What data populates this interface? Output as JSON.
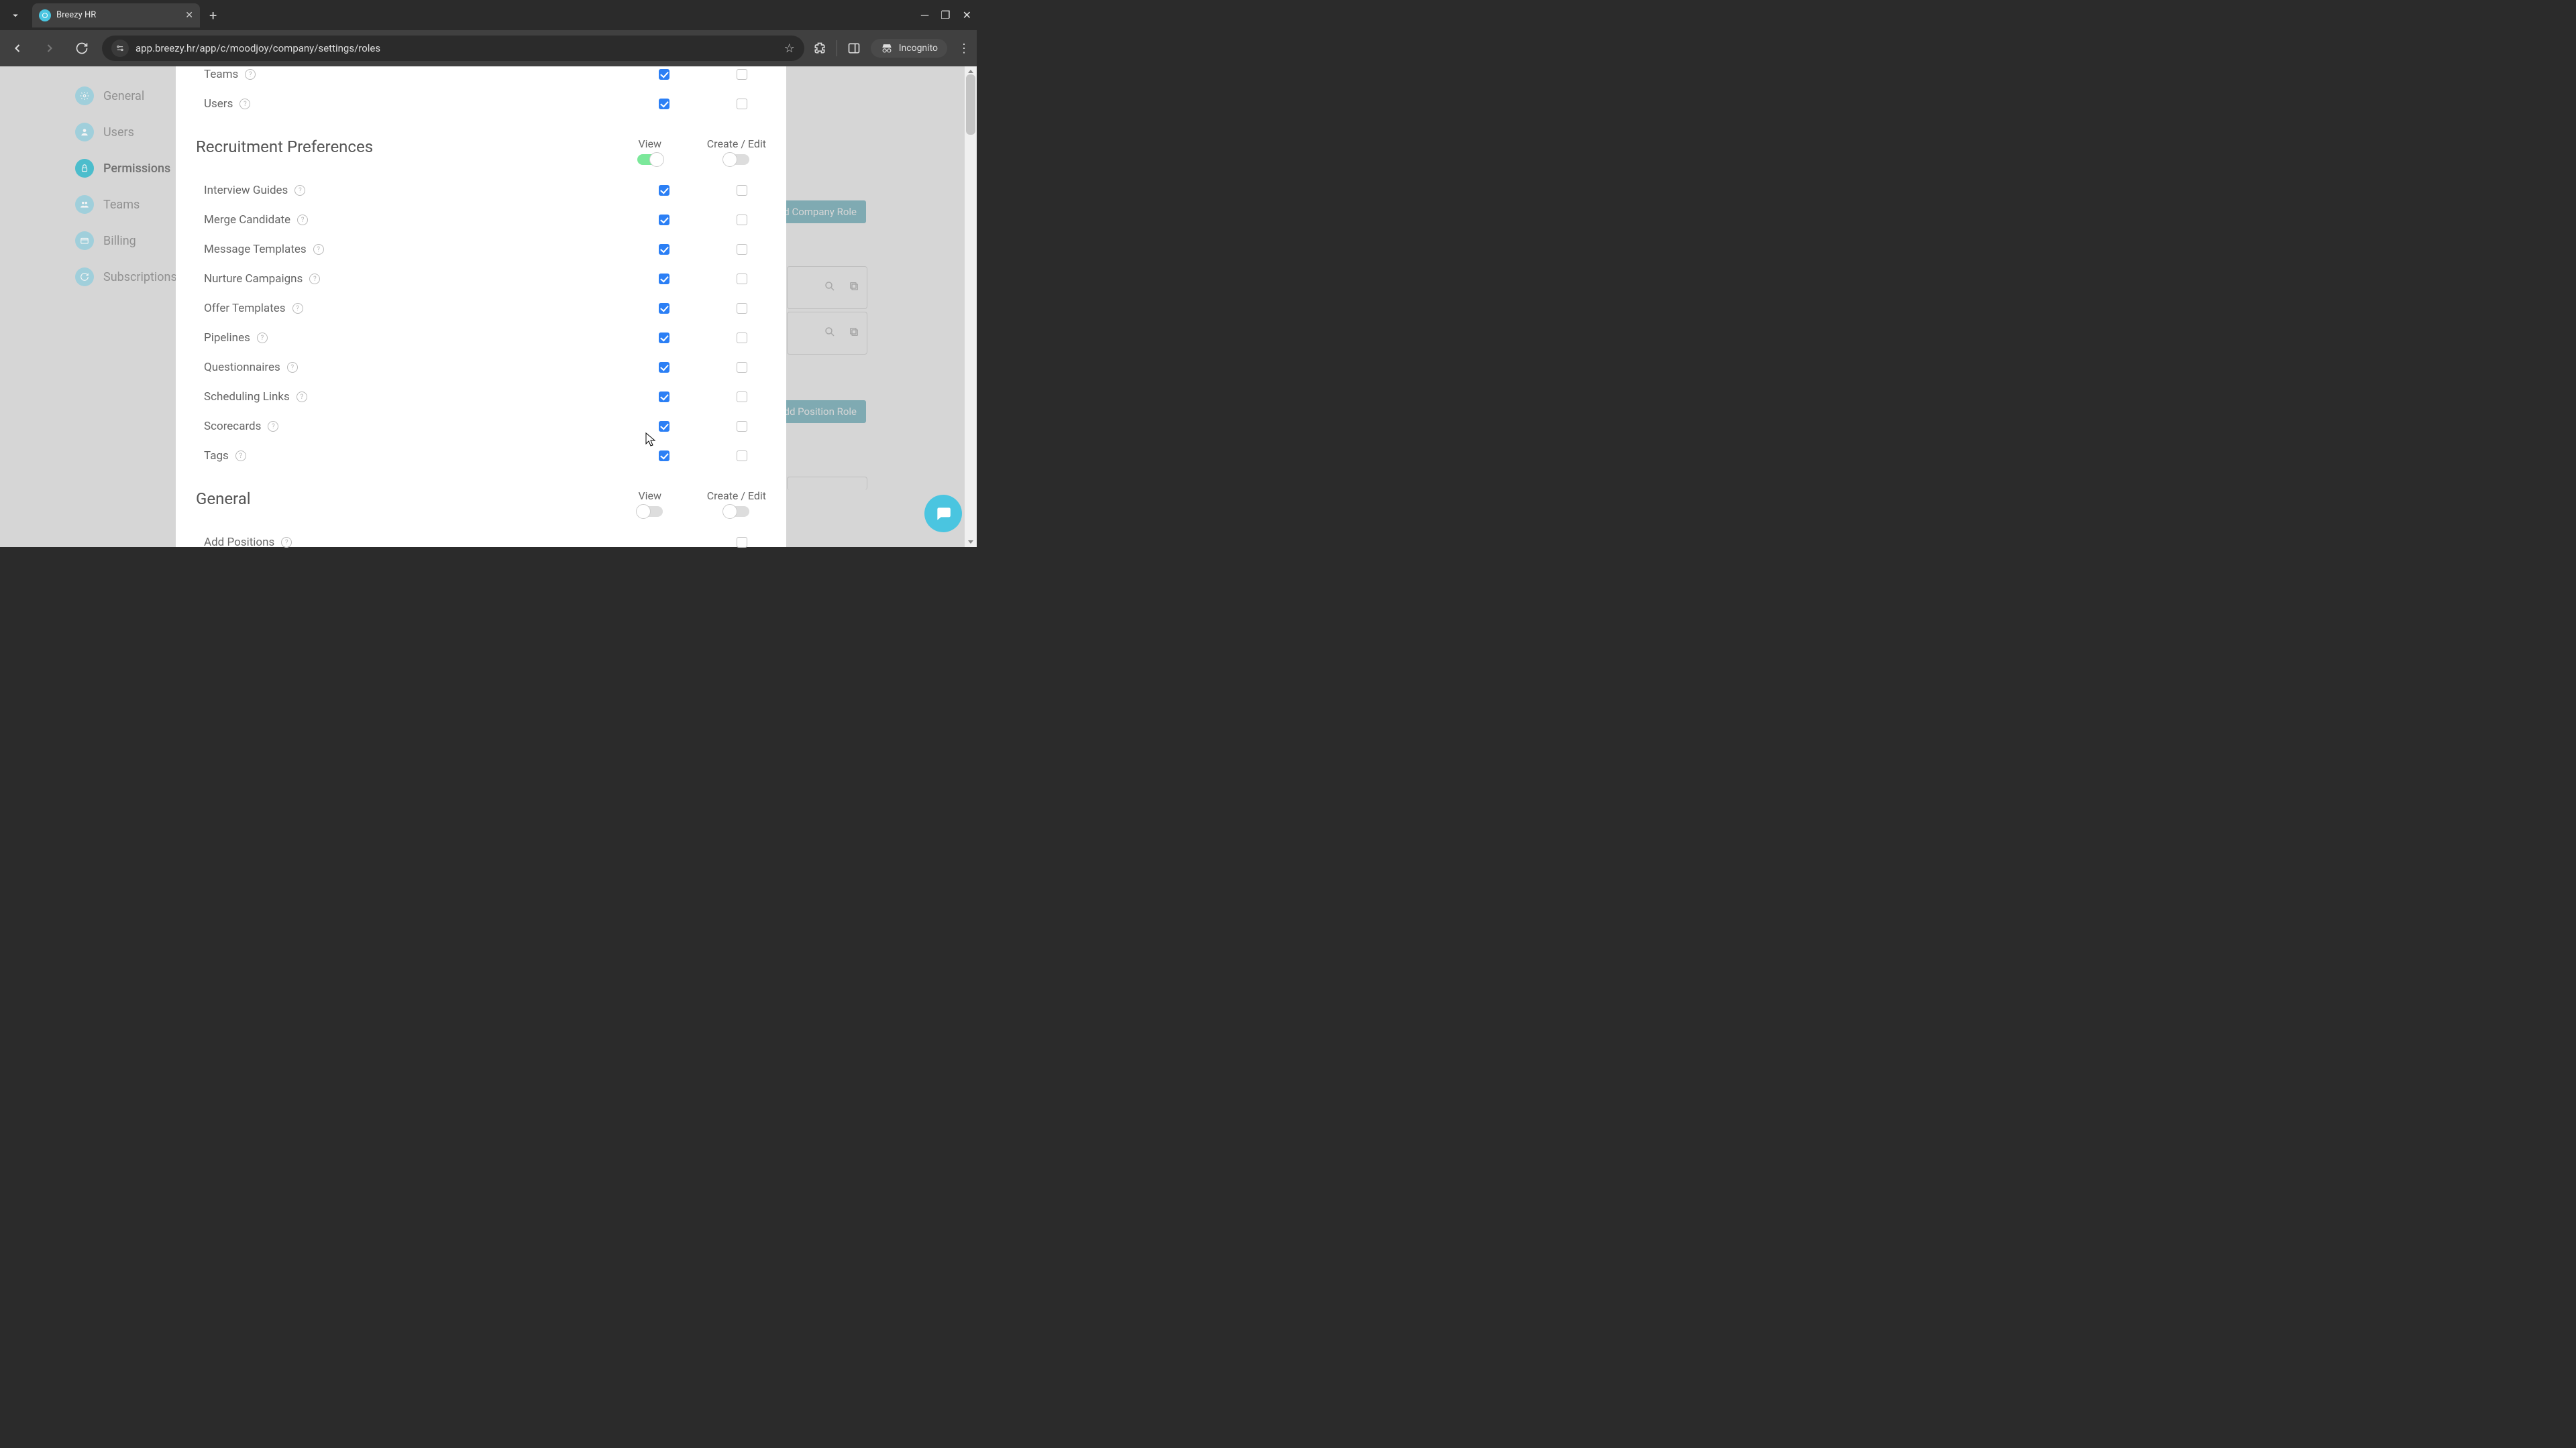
{
  "browser": {
    "tab_title": "Breezy HR",
    "url": "app.breezy.hr/app/c/moodjoy/company/settings/roles",
    "incognito_label": "Incognito"
  },
  "sidebar": {
    "items": [
      {
        "label": "General",
        "active": false
      },
      {
        "label": "Users",
        "active": false
      },
      {
        "label": "Permissions",
        "active": true
      },
      {
        "label": "Teams",
        "active": false
      },
      {
        "label": "Billing",
        "active": false
      },
      {
        "label": "Subscriptions",
        "active": false
      }
    ]
  },
  "background": {
    "add_company_role": "Add Company Role",
    "add_position_role": "Add Position Role"
  },
  "top_rows": [
    {
      "label": "Teams",
      "view": true,
      "edit": false
    },
    {
      "label": "Users",
      "view": true,
      "edit": false
    }
  ],
  "sections": [
    {
      "title": "Recruitment Preferences",
      "view_header": "View",
      "edit_header": "Create / Edit",
      "view_toggle_on": true,
      "edit_toggle_on": false,
      "rows": [
        {
          "label": "Interview Guides",
          "view": true,
          "edit": false
        },
        {
          "label": "Merge Candidate",
          "view": true,
          "edit": false
        },
        {
          "label": "Message Templates",
          "view": true,
          "edit": false
        },
        {
          "label": "Nurture Campaigns",
          "view": true,
          "edit": false
        },
        {
          "label": "Offer Templates",
          "view": true,
          "edit": false
        },
        {
          "label": "Pipelines",
          "view": true,
          "edit": false
        },
        {
          "label": "Questionnaires",
          "view": true,
          "edit": false
        },
        {
          "label": "Scheduling Links",
          "view": true,
          "edit": false
        },
        {
          "label": "Scorecards",
          "view": true,
          "edit": false
        },
        {
          "label": "Tags",
          "view": true,
          "edit": false
        }
      ]
    },
    {
      "title": "General",
      "view_header": "View",
      "edit_header": "Create / Edit",
      "view_toggle_on": false,
      "edit_toggle_on": false,
      "rows": [
        {
          "label": "Add Positions",
          "view": null,
          "edit": false
        }
      ]
    }
  ]
}
